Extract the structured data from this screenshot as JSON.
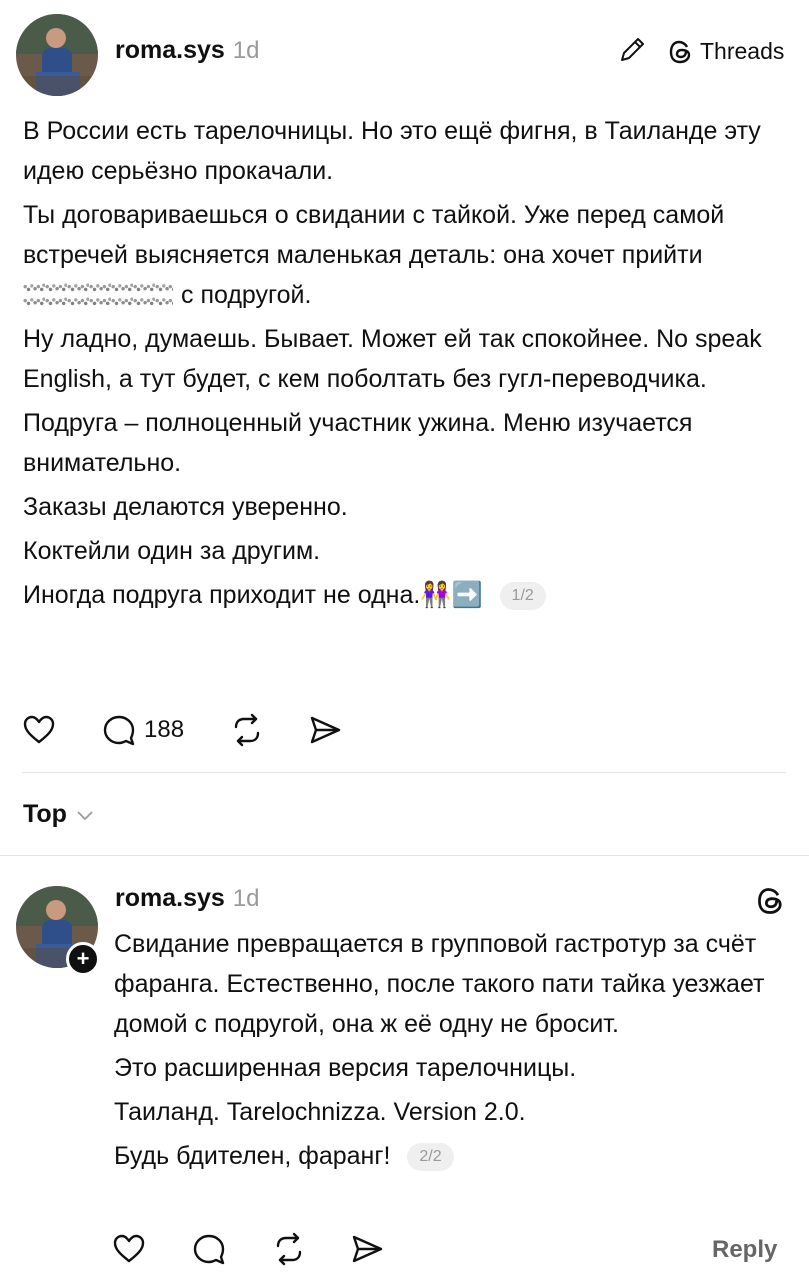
{
  "post": {
    "username": "roma.sys",
    "time": "1d",
    "brand": "Threads",
    "paragraphs": [
      "В России есть тарелочницы. Но это ещё фигня, в Таиланде эту идею серьёзно прокачали.",
      "Ты договариваешься о свидании с тайкой. Уже перед самой встречей выясняется маленькая деталь: она хочет прийти"
    ],
    "blurred_line_suffix": "с подругой.",
    "paragraphs_after": [
      "Ну ладно, думаешь. Бывает. Может ей так спокойнее. No speak English, а тут будет, с кем поболтать без гугл-переводчика.",
      "Подруга – полноценный участник ужина. Меню изучается внимательно.",
      "Заказы делаются уверенно.",
      "Коктейли  один за другим."
    ],
    "last_line": "Иногда подруга приходит не одна.",
    "last_line_emoji": "👭➡️",
    "counter": "1/2",
    "replies_count": "188"
  },
  "sort": {
    "label": "Top"
  },
  "reply": {
    "username": "roma.sys",
    "time": "1d",
    "paragraphs": [
      "Свидание превращается в групповой гастротур за счёт фаранга. Естественно, после такого пати тайка уезжает домой с подругой, она ж её одну не бросит.",
      "Это расширенная версия тарелочницы.",
      "Таиланд. Tarelochnizza. Version 2.0."
    ],
    "last_line": "Будь бдителен, фаранг!",
    "counter": "2/2",
    "reply_label": "Reply"
  },
  "icons": {
    "edit": "pencil-icon",
    "threads": "threads-logo-icon",
    "like": "heart-icon",
    "comment": "comment-icon",
    "repost": "repost-icon",
    "share": "send-icon",
    "sort_chevron": "chevron-down-icon",
    "add": "plus-icon"
  }
}
